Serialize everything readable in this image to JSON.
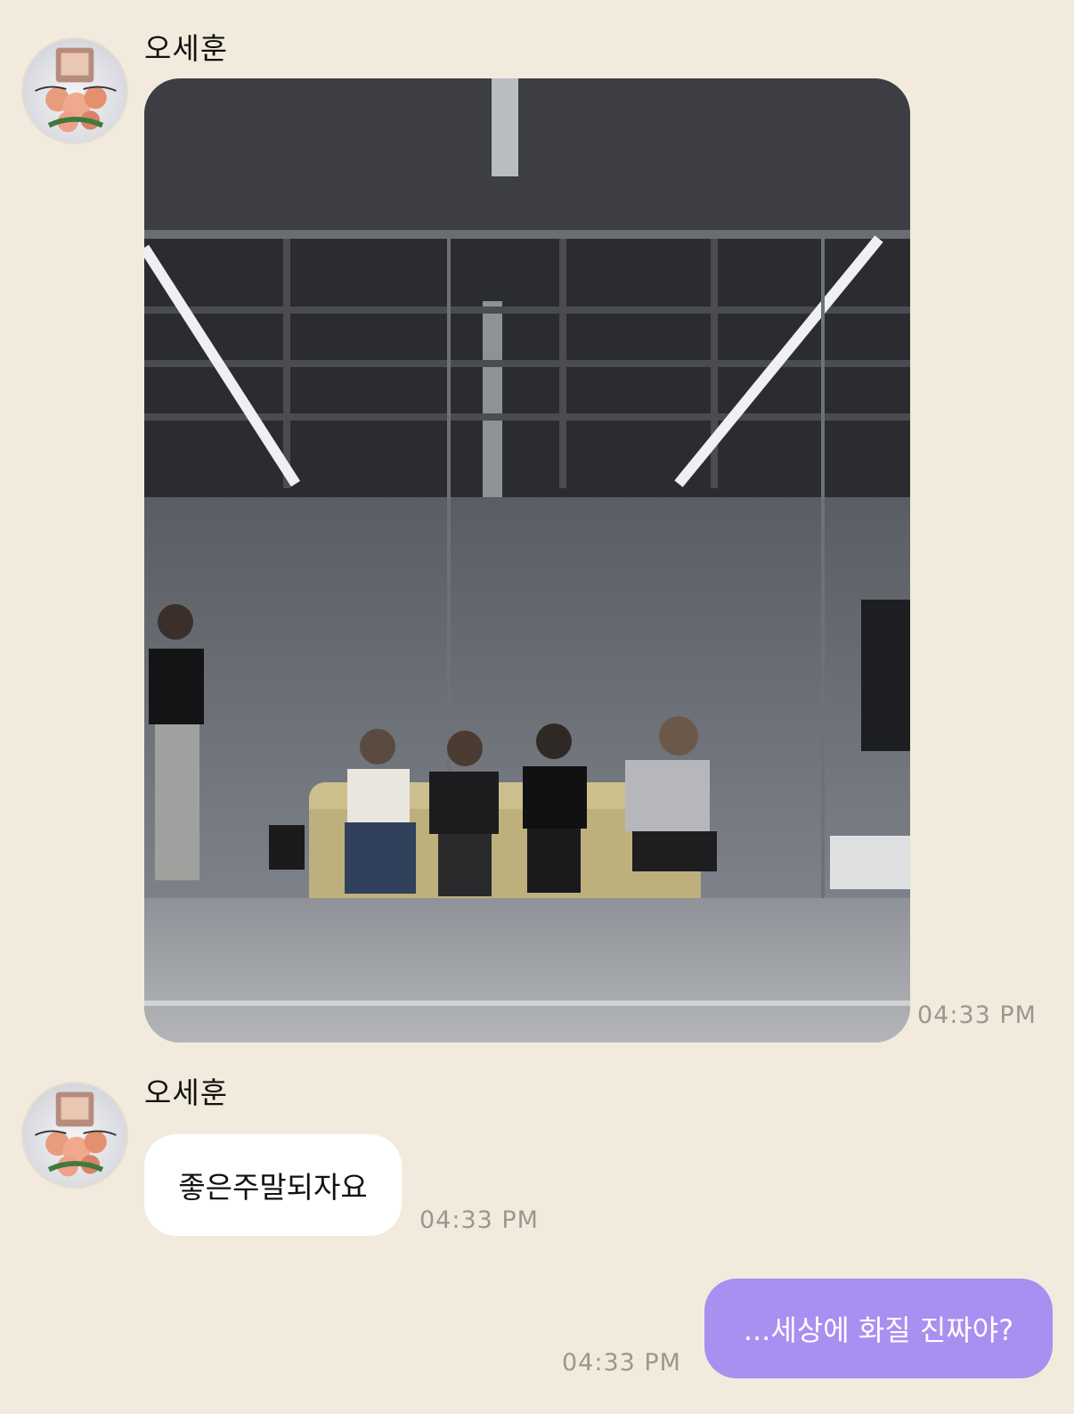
{
  "messages": [
    {
      "sender": "오세훈",
      "type": "photo",
      "time": "04:33 PM",
      "avatar_icon": "profile-photo-bouquet",
      "photo_icon": "blurred-photo-dance-studio-group"
    },
    {
      "sender": "오세훈",
      "type": "text",
      "text": "좋은주말되자요",
      "time": "04:33 PM",
      "avatar_icon": "profile-photo-bouquet"
    },
    {
      "sender": "me",
      "type": "text",
      "text": "...세상에 화질 진짜야?",
      "time": "04:33 PM"
    }
  ],
  "colors": {
    "background": "#f2ebdd",
    "incoming_bubble": "#ffffff",
    "outgoing_bubble": "#a88ff0",
    "time_text": "#9c968e"
  }
}
